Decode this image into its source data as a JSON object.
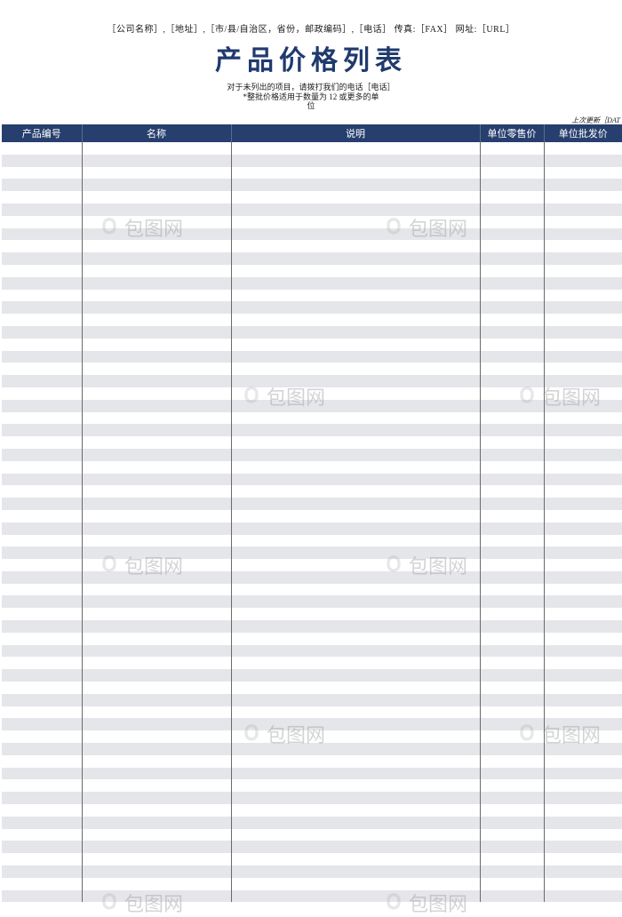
{
  "header": {
    "company_info": "［公司名称］,［地址］,［市/县/自治区，省份，邮政编码］,［电话］ 传真:［FAX］ 网址:［URL］",
    "title": "产品价格列表",
    "subtitle1": "对于未列出的项目，请拨打我们的电话［电话］",
    "subtitle2_line1": "*整批价格适用于数量为 12 或更多的单",
    "subtitle2_line2": "位",
    "last_update": "上次更新［DAT"
  },
  "columns": [
    {
      "key": "id",
      "label": "产品编号"
    },
    {
      "key": "name",
      "label": "名称"
    },
    {
      "key": "desc",
      "label": "说明"
    },
    {
      "key": "retail",
      "label": "单位零售价"
    },
    {
      "key": "wholesale",
      "label": "单位批发价"
    }
  ],
  "rows_count": 62,
  "watermark_text": "包图网",
  "colors": {
    "header_bg": "#273f6e",
    "title_color": "#1f3a6e",
    "row_alt": "#e4e6e9"
  }
}
